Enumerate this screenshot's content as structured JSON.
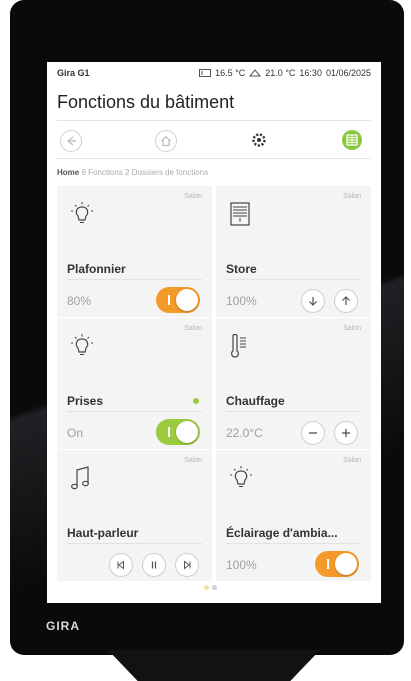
{
  "device": {
    "brand": "GIRA"
  },
  "status_bar": {
    "app_name": "Gira G1",
    "outside_temp": "16.5 °C",
    "inside_temp": "21.0 °C",
    "time": "16:30",
    "date": "01/06/2025"
  },
  "page_title": "Fonctions du bâtiment",
  "breadcrumb": {
    "home": "Home",
    "rest": "9 Fonctions 2 Dossiers de fonctions"
  },
  "nav": {
    "back_icon": "arrow-left-icon",
    "home_icon": "house-icon",
    "settings_icon": "gear-icon",
    "grid_icon": "grid-icon",
    "active_color": "#8dc63f"
  },
  "colors": {
    "accent_orange": "#f39a2b",
    "accent_green": "#9bcb3c",
    "tile_bg": "#f4f4f4"
  },
  "tiles": [
    {
      "room": "Salon",
      "name": "Plafonnier",
      "value": "80%",
      "icon": "light-bulb-icon",
      "toggle": "on"
    },
    {
      "room": "Salon",
      "name": "Store",
      "value": "100%",
      "icon": "blind-icon",
      "buttons": [
        "down-arrow-icon",
        "up-arrow-icon"
      ]
    },
    {
      "room": "Salon",
      "name": "Prises",
      "value": "On",
      "icon": "light-bulb-icon",
      "toggle": "on"
    },
    {
      "room": "Salon",
      "name": "Chauffage",
      "value": "22.0°C",
      "icon": "thermometer-icon",
      "buttons": [
        "minus-icon",
        "plus-icon"
      ]
    },
    {
      "room": "Salon",
      "name": "Haut-parleur",
      "value": "",
      "icon": "music-note-icon",
      "buttons": [
        "previous-icon",
        "pause-icon",
        "next-icon"
      ]
    },
    {
      "room": "Salon",
      "name": "Éclairage d'ambia...",
      "value": "100%",
      "icon": "light-bulb-icon",
      "toggle": "on"
    }
  ],
  "pagination": {
    "pages": 2,
    "active": 1
  }
}
